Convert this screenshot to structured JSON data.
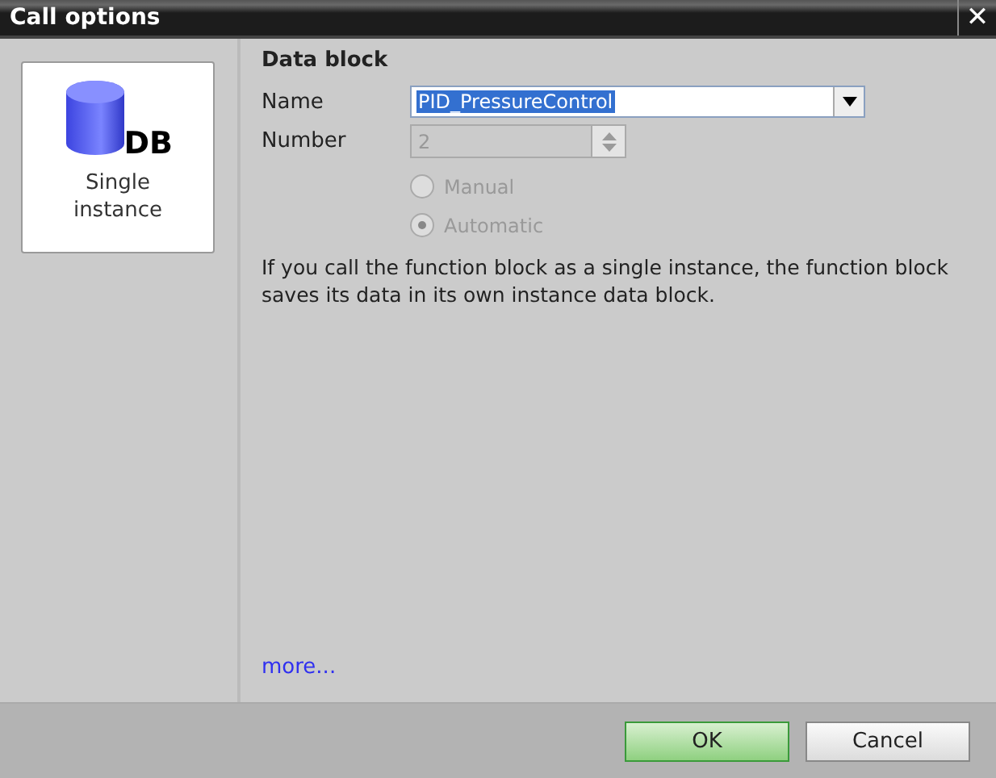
{
  "window": {
    "title": "Call options",
    "close": "✕"
  },
  "sidebar": {
    "items": [
      {
        "label": "Single instance",
        "icon_text": "DB",
        "selected": true
      }
    ]
  },
  "section_title": "Data block",
  "name_field": {
    "label": "Name",
    "value": "PID_PressureControl",
    "highlighted": true,
    "disabled": false
  },
  "number_field": {
    "label": "Number",
    "value": "2",
    "disabled": true
  },
  "radios": [
    {
      "label": "Manual",
      "selected": false,
      "disabled": true
    },
    {
      "label": "Automatic",
      "selected": true,
      "disabled": true
    }
  ],
  "description": "If you call the function block as a single instance, the function block saves its data in its own instance data block.",
  "link": "more...",
  "buttons": [
    {
      "label": "OK",
      "kind": "primary"
    },
    {
      "label": "Cancel",
      "kind": "secondary"
    }
  ]
}
